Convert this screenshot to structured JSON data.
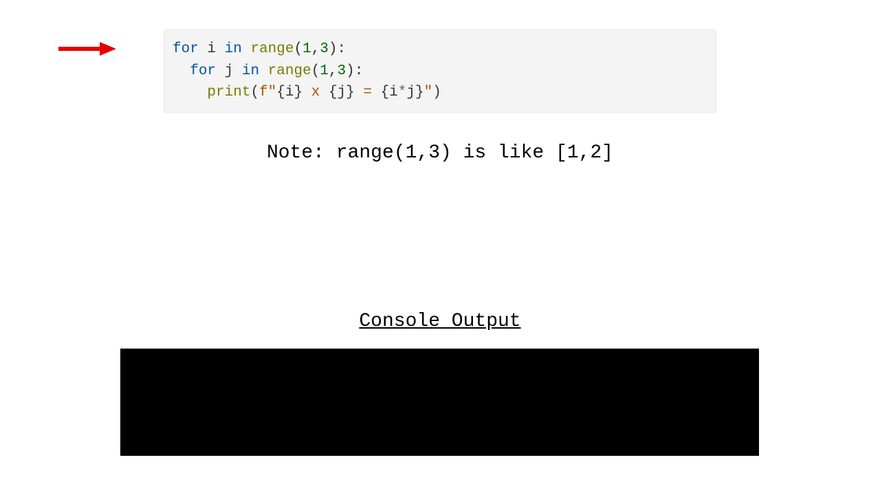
{
  "arrow": {
    "color": "#e60000"
  },
  "code": {
    "line1": {
      "kw1": "for",
      "var1": " i ",
      "kw2": "in",
      "sp": " ",
      "fn": "range",
      "open": "(",
      "n1": "1",
      "comma": ",",
      "n2": "3",
      "close": ")",
      "colon": ":"
    },
    "line2": {
      "indent": "  ",
      "kw1": "for",
      "var1": " j ",
      "kw2": "in",
      "sp": " ",
      "fn": "range",
      "open": "(",
      "n1": "1",
      "comma": ",",
      "n2": "3",
      "close": ")",
      "colon": ":"
    },
    "line3": {
      "indent": "    ",
      "fn": "print",
      "open": "(",
      "fpre": "f\"",
      "b1o": "{",
      "v1": "i",
      "b1c": "}",
      "mid1": " x ",
      "b2o": "{",
      "v2": "j",
      "b2c": "}",
      "mid2": " = ",
      "b3o": "{",
      "e1": "i",
      "op": "*",
      "e2": "j",
      "b3c": "}",
      "strend": "\"",
      "close": ")"
    }
  },
  "note_text": "Note: range(1,3) is like [1,2]",
  "console_title": "Console Output",
  "console_output": ""
}
